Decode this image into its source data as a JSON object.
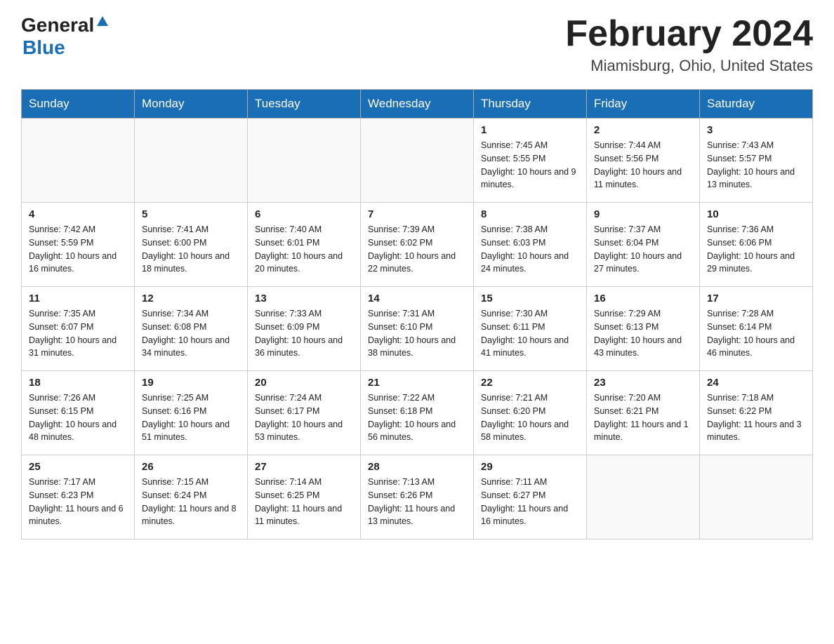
{
  "header": {
    "logo_general": "General",
    "logo_blue": "Blue",
    "month_title": "February 2024",
    "location": "Miamisburg, Ohio, United States"
  },
  "weekdays": [
    "Sunday",
    "Monday",
    "Tuesday",
    "Wednesday",
    "Thursday",
    "Friday",
    "Saturday"
  ],
  "weeks": [
    [
      {
        "day": "",
        "info": ""
      },
      {
        "day": "",
        "info": ""
      },
      {
        "day": "",
        "info": ""
      },
      {
        "day": "",
        "info": ""
      },
      {
        "day": "1",
        "info": "Sunrise: 7:45 AM\nSunset: 5:55 PM\nDaylight: 10 hours and 9 minutes."
      },
      {
        "day": "2",
        "info": "Sunrise: 7:44 AM\nSunset: 5:56 PM\nDaylight: 10 hours and 11 minutes."
      },
      {
        "day": "3",
        "info": "Sunrise: 7:43 AM\nSunset: 5:57 PM\nDaylight: 10 hours and 13 minutes."
      }
    ],
    [
      {
        "day": "4",
        "info": "Sunrise: 7:42 AM\nSunset: 5:59 PM\nDaylight: 10 hours and 16 minutes."
      },
      {
        "day": "5",
        "info": "Sunrise: 7:41 AM\nSunset: 6:00 PM\nDaylight: 10 hours and 18 minutes."
      },
      {
        "day": "6",
        "info": "Sunrise: 7:40 AM\nSunset: 6:01 PM\nDaylight: 10 hours and 20 minutes."
      },
      {
        "day": "7",
        "info": "Sunrise: 7:39 AM\nSunset: 6:02 PM\nDaylight: 10 hours and 22 minutes."
      },
      {
        "day": "8",
        "info": "Sunrise: 7:38 AM\nSunset: 6:03 PM\nDaylight: 10 hours and 24 minutes."
      },
      {
        "day": "9",
        "info": "Sunrise: 7:37 AM\nSunset: 6:04 PM\nDaylight: 10 hours and 27 minutes."
      },
      {
        "day": "10",
        "info": "Sunrise: 7:36 AM\nSunset: 6:06 PM\nDaylight: 10 hours and 29 minutes."
      }
    ],
    [
      {
        "day": "11",
        "info": "Sunrise: 7:35 AM\nSunset: 6:07 PM\nDaylight: 10 hours and 31 minutes."
      },
      {
        "day": "12",
        "info": "Sunrise: 7:34 AM\nSunset: 6:08 PM\nDaylight: 10 hours and 34 minutes."
      },
      {
        "day": "13",
        "info": "Sunrise: 7:33 AM\nSunset: 6:09 PM\nDaylight: 10 hours and 36 minutes."
      },
      {
        "day": "14",
        "info": "Sunrise: 7:31 AM\nSunset: 6:10 PM\nDaylight: 10 hours and 38 minutes."
      },
      {
        "day": "15",
        "info": "Sunrise: 7:30 AM\nSunset: 6:11 PM\nDaylight: 10 hours and 41 minutes."
      },
      {
        "day": "16",
        "info": "Sunrise: 7:29 AM\nSunset: 6:13 PM\nDaylight: 10 hours and 43 minutes."
      },
      {
        "day": "17",
        "info": "Sunrise: 7:28 AM\nSunset: 6:14 PM\nDaylight: 10 hours and 46 minutes."
      }
    ],
    [
      {
        "day": "18",
        "info": "Sunrise: 7:26 AM\nSunset: 6:15 PM\nDaylight: 10 hours and 48 minutes."
      },
      {
        "day": "19",
        "info": "Sunrise: 7:25 AM\nSunset: 6:16 PM\nDaylight: 10 hours and 51 minutes."
      },
      {
        "day": "20",
        "info": "Sunrise: 7:24 AM\nSunset: 6:17 PM\nDaylight: 10 hours and 53 minutes."
      },
      {
        "day": "21",
        "info": "Sunrise: 7:22 AM\nSunset: 6:18 PM\nDaylight: 10 hours and 56 minutes."
      },
      {
        "day": "22",
        "info": "Sunrise: 7:21 AM\nSunset: 6:20 PM\nDaylight: 10 hours and 58 minutes."
      },
      {
        "day": "23",
        "info": "Sunrise: 7:20 AM\nSunset: 6:21 PM\nDaylight: 11 hours and 1 minute."
      },
      {
        "day": "24",
        "info": "Sunrise: 7:18 AM\nSunset: 6:22 PM\nDaylight: 11 hours and 3 minutes."
      }
    ],
    [
      {
        "day": "25",
        "info": "Sunrise: 7:17 AM\nSunset: 6:23 PM\nDaylight: 11 hours and 6 minutes."
      },
      {
        "day": "26",
        "info": "Sunrise: 7:15 AM\nSunset: 6:24 PM\nDaylight: 11 hours and 8 minutes."
      },
      {
        "day": "27",
        "info": "Sunrise: 7:14 AM\nSunset: 6:25 PM\nDaylight: 11 hours and 11 minutes."
      },
      {
        "day": "28",
        "info": "Sunrise: 7:13 AM\nSunset: 6:26 PM\nDaylight: 11 hours and 13 minutes."
      },
      {
        "day": "29",
        "info": "Sunrise: 7:11 AM\nSunset: 6:27 PM\nDaylight: 11 hours and 16 minutes."
      },
      {
        "day": "",
        "info": ""
      },
      {
        "day": "",
        "info": ""
      }
    ]
  ]
}
